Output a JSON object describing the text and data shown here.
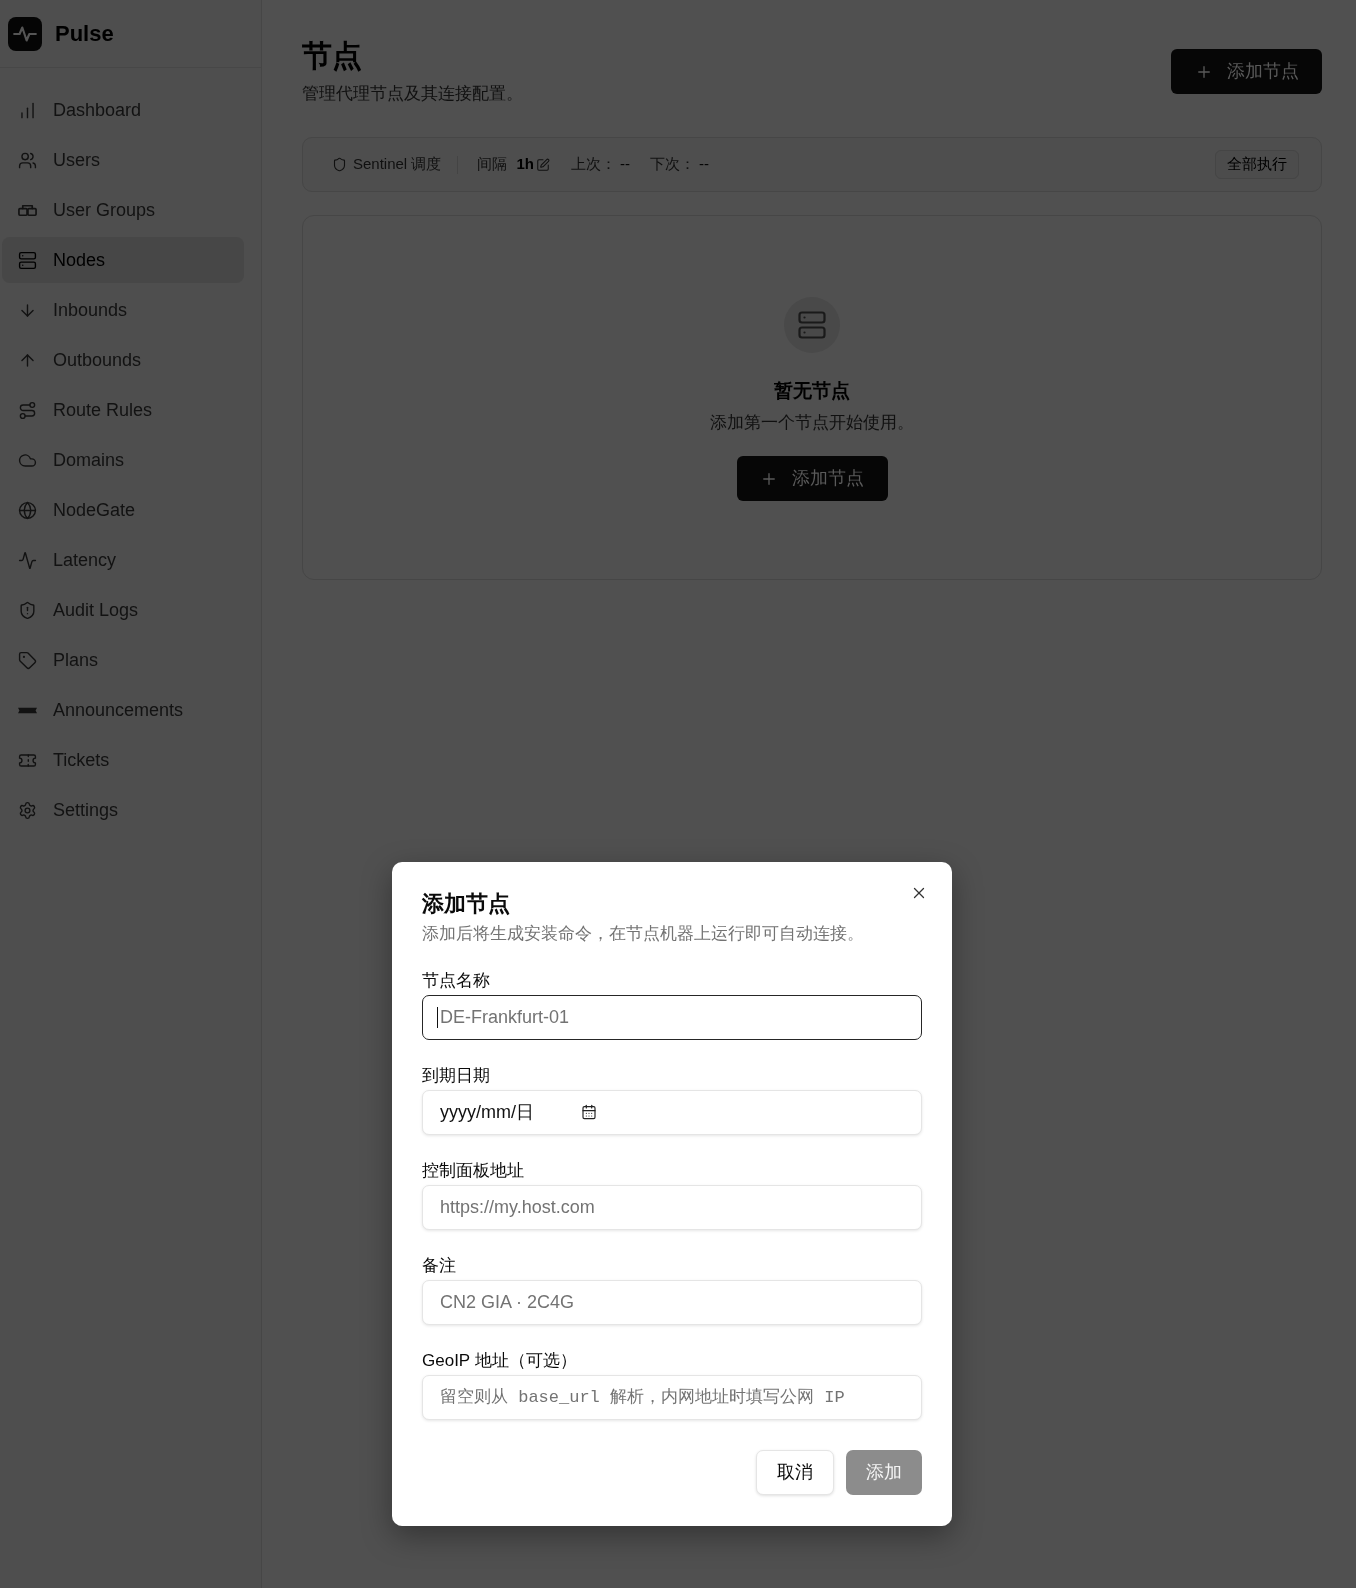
{
  "app": {
    "name": "Pulse"
  },
  "sidebar": {
    "items": [
      {
        "label": "Dashboard",
        "selected": false
      },
      {
        "label": "Users",
        "selected": false
      },
      {
        "label": "User Groups",
        "selected": false
      },
      {
        "label": "Nodes",
        "selected": true
      },
      {
        "label": "Inbounds",
        "selected": false
      },
      {
        "label": "Outbounds",
        "selected": false
      },
      {
        "label": "Route Rules",
        "selected": false
      },
      {
        "label": "Domains",
        "selected": false
      },
      {
        "label": "NodeGate",
        "selected": false
      },
      {
        "label": "Latency",
        "selected": false
      },
      {
        "label": "Audit Logs",
        "selected": false
      },
      {
        "label": "Plans",
        "selected": false
      },
      {
        "label": "Announcements",
        "selected": false
      },
      {
        "label": "Tickets",
        "selected": false
      },
      {
        "label": "Settings",
        "selected": false
      }
    ]
  },
  "header": {
    "title": "节点",
    "subtitle": "管理代理节点及其连接配置。",
    "add_button": "添加节点"
  },
  "scheduler": {
    "label": "Sentinel 调度",
    "interval": {
      "label": "间隔",
      "value": "1h"
    },
    "last_run": {
      "label": "上次：",
      "value": "--"
    },
    "next_run": {
      "label": "下次：",
      "value": "--"
    },
    "run_all_button": "全部执行"
  },
  "empty_state": {
    "title": "暂无节点",
    "description": "添加第一个节点开始使用。",
    "button": "添加节点"
  },
  "dialog": {
    "title": "添加节点",
    "description": "添加后将生成安装命令，在节点机器上运行即可自动连接。",
    "fields": [
      {
        "kind": "text",
        "label": "节点名称",
        "placeholder": "DE-Frankfurt-01",
        "focused": true
      },
      {
        "kind": "date",
        "label": "到期日期",
        "placeholder": "yyyy/mm/日",
        "focused": false
      },
      {
        "kind": "text",
        "label": "控制面板地址",
        "placeholder": "https://my.host.com",
        "focused": false
      },
      {
        "kind": "text",
        "label": "备注",
        "placeholder": "CN2 GIA · 2C4G",
        "focused": false
      },
      {
        "kind": "monospace",
        "label": "GeoIP 地址（可选）",
        "placeholder": "留空则从 base_url 解析，内网地址时填写公网 IP",
        "focused": false
      }
    ],
    "buttons": [
      {
        "kind": "secondary",
        "label": "取消",
        "disabled": false
      },
      {
        "kind": "primary",
        "label": "添加",
        "disabled": true
      }
    ]
  }
}
